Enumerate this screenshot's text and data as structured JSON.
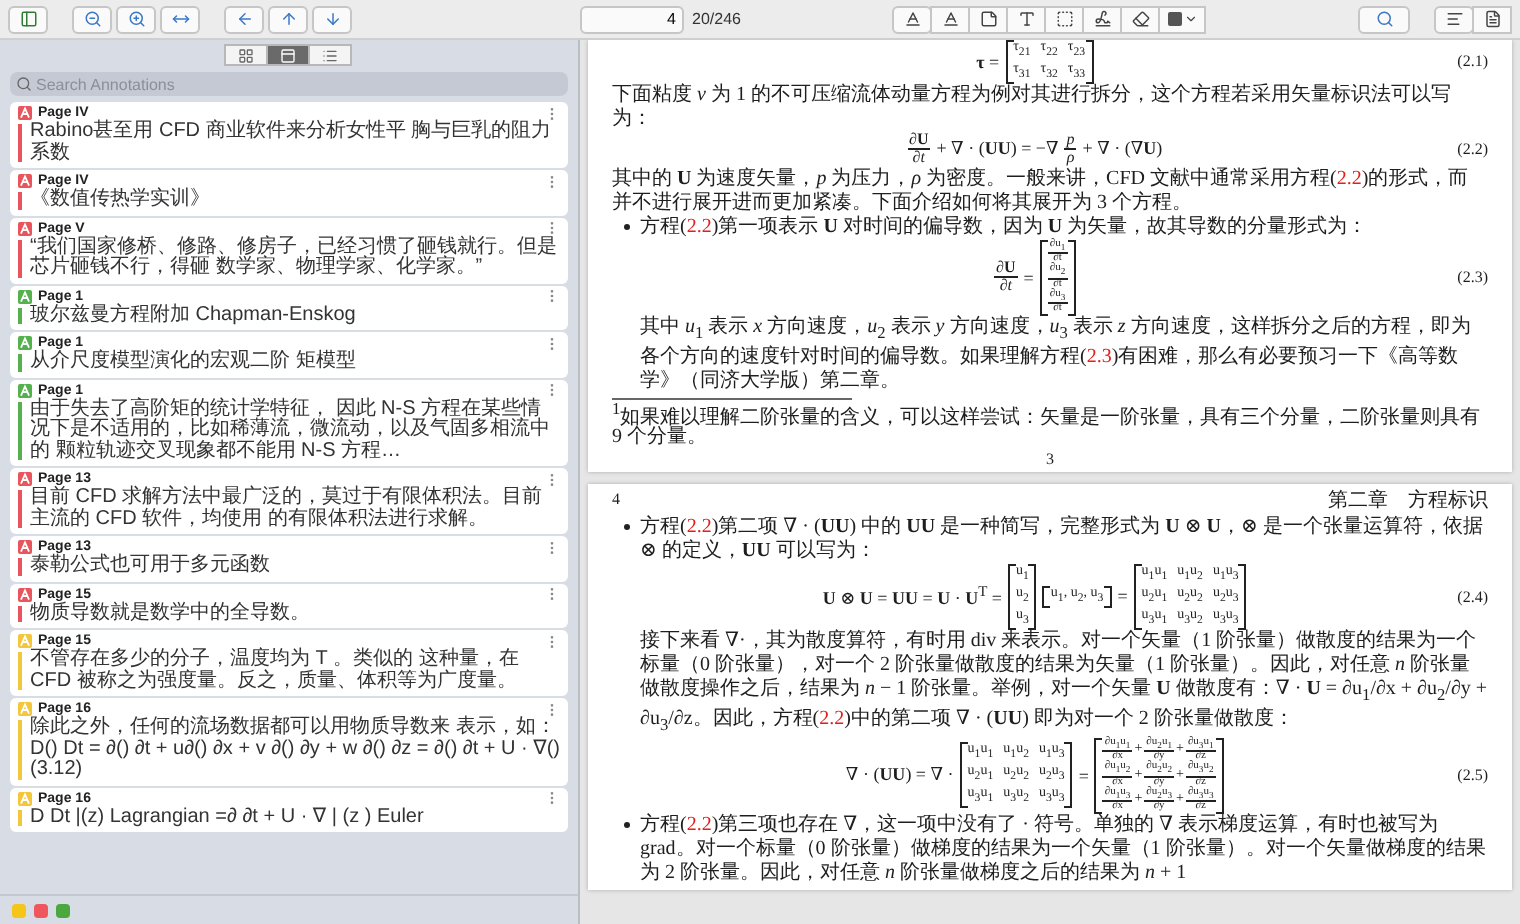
{
  "toolbar": {
    "page_field": {
      "value": "4"
    },
    "page_count": "20/246"
  },
  "sidebar": {
    "view_tabs": [
      {
        "kind": "thumbnails",
        "selected": false
      },
      {
        "kind": "annotations",
        "selected": true
      },
      {
        "kind": "outline",
        "selected": false
      }
    ],
    "search": {
      "placeholder": "Search Annotations"
    },
    "annotations": [
      {
        "page": "Page IV",
        "color": "#e8555c",
        "text": "Rabino甚至用 CFD 商业软件来分析女性平 胸与巨乳的阻力系数"
      },
      {
        "page": "Page IV",
        "color": "#e8555c",
        "text": "《数值传热学实训》"
      },
      {
        "page": "Page V",
        "color": "#e8555c",
        "text": "“我们国家修桥、修路、修房子，已经习惯了砸钱就行。但是芯片砸钱不行，得砸 数学家、物理学家、化学家。”"
      },
      {
        "page": "Page 1",
        "color": "#55b04e",
        "text": "玻尔兹曼方程附加 Chapman-Enskog"
      },
      {
        "page": "Page 1",
        "color": "#55b04e",
        "text": "从介尺度模型演化的宏观二阶 矩模型"
      },
      {
        "page": "Page 1",
        "color": "#55b04e",
        "text": "由于失去了高阶矩的统计学特征， 因此 N-S 方程在某些情况下是不适用的，比如稀薄流，微流动，以及气固多相流中的 颗粒轨迹交叉现象都不能用 N-S 方程…"
      },
      {
        "page": "Page 13",
        "color": "#e8555c",
        "text": "目前 CFD 求解方法中最广泛的，莫过于有限体积法。目前主流的 CFD 软件，均使用 的有限体积法进行求解。"
      },
      {
        "page": "Page 13",
        "color": "#e8555c",
        "text": "泰勒公式也可用于多元函数"
      },
      {
        "page": "Page 15",
        "color": "#e8555c",
        "text": "物质导数就是数学中的全导数。"
      },
      {
        "page": "Page 15",
        "color": "#f2c73c",
        "text": "不管存在多少的分子，温度均为 T 。类似的 这种量，在 CFD 被称之为强度量。反之，质量、体积等为广度量。"
      },
      {
        "page": "Page 16",
        "color": "#f2c73c",
        "text": "除此之外，任何的流场数据都可以用物质导数来 表示，如： D() Dt = ∂() ∂t + u∂() ∂x + v ∂() ∂y + w ∂() ∂z = ∂() ∂t + U · ∇() (3.12)"
      },
      {
        "page": "Page 16",
        "color": "#f2c73c",
        "text": "D Dt |(z) Lagrangian =∂ ∂t + U · ∇ | (z ) Euler"
      }
    ],
    "color_filters": [
      {
        "color": "#f5c518"
      },
      {
        "color": "#f0575c"
      },
      {
        "color": "#4aa83f"
      }
    ]
  },
  "document": {
    "pages": [
      {
        "blocks": [
          {
            "kind": "equation",
            "number": "(2.1)",
            "parts": [
              {
                "kind": "text",
                "text": "**τ** ="
              },
              {
                "kind": "matrix",
                "rows": [
                  [
                    "τ$_{21}$",
                    "τ$_{22}$",
                    "τ$_{23}$"
                  ],
                  [
                    "τ$_{31}$",
                    "τ$_{32}$",
                    "τ$_{33}$"
                  ]
                ]
              }
            ]
          },
          {
            "kind": "paragraph",
            "segments": [
              {
                "kind": "plain",
                "text": "下面粘度 *ν* 为 1 的不可压缩流体动量方程为例对其进行拆分，这个方程若采用矢量标识法可以写为："
              }
            ]
          },
          {
            "kind": "equation",
            "number": "(2.2)",
            "parts": [
              {
                "kind": "frac",
                "num": "∂**U**",
                "den": "∂*t*"
              },
              {
                "kind": "text",
                "text": "+ ∇ · (**UU**) = −∇"
              },
              {
                "kind": "frac",
                "num": "*p*",
                "den": "*ρ*"
              },
              {
                "kind": "text",
                "text": "+ ∇ · (∇**U**)"
              }
            ]
          },
          {
            "kind": "paragraph",
            "segments": [
              {
                "kind": "plain",
                "text": "其中的 **U** 为速度矢量，*p* 为压力，*ρ* 为密度。一般来讲，CFD 文献中通常采用方程("
              },
              {
                "kind": "ref",
                "text": "2.2"
              },
              {
                "kind": "plain",
                "text": ")的形式，而并不进行展开进而更加紧凑。下面介绍如何将其展开为 3 个方程。"
              }
            ]
          },
          {
            "kind": "bullet",
            "segments": [
              {
                "kind": "plain",
                "text": "方程("
              },
              {
                "kind": "ref",
                "text": "2.2"
              },
              {
                "kind": "plain",
                "text": ")第一项表示 **U** 对时间的偏导数，因为 **U** 为矢量，故其导数的分量形式为："
              }
            ]
          },
          {
            "kind": "equation",
            "number": "(2.3)",
            "parts": [
              {
                "kind": "frac",
                "num": "∂**U**",
                "den": "∂*t*"
              },
              {
                "kind": "text",
                "text": "="
              },
              {
                "kind": "matrix",
                "rows": [
                  [
                    {
                      "num": "∂u$_{1}$",
                      "den": "∂t"
                    }
                  ],
                  [
                    {
                      "num": "∂u$_{2}$",
                      "den": "∂t"
                    }
                  ],
                  [
                    {
                      "num": "∂u$_{3}$",
                      "den": "∂t"
                    }
                  ]
                ]
              }
            ]
          },
          {
            "kind": "indented",
            "segments": [
              {
                "kind": "plain",
                "text": "其中 *u*$_{1}$ 表示 *x* 方向速度，*u*$_{2}$ 表示 *y* 方向速度，*u*$_{3}$ 表示 *z* 方向速度，这样拆分之后的方程，即为各个方向的速度针对时间的偏导数。如果理解方程("
              },
              {
                "kind": "ref",
                "text": "2.3"
              },
              {
                "kind": "plain",
                "text": ")有困难，那么有必要预习一下《高等数学》（同济大学版）第二章。"
              }
            ]
          }
        ],
        "footnote": "$^{1}$如果难以理解二阶张量的含义，可以这样尝试：矢量是一阶张量，具有三个分量，二阶张量则具有 9 个分量。",
        "page_number": "3"
      },
      {
        "header": {
          "number": "4",
          "chapter": "第二章　方程标识"
        },
        "blocks": [
          {
            "kind": "bullet",
            "segments": [
              {
                "kind": "plain",
                "text": "方程("
              },
              {
                "kind": "ref",
                "text": "2.2"
              },
              {
                "kind": "plain",
                "text": ")第二项 ∇ · (**UU**) 中的 **UU** 是一种简写，完整形式为 **U** ⊗ **U**，⊗ 是一个张量运算符，依据 ⊗ 的定义，**UU** 可以写为："
              }
            ]
          },
          {
            "kind": "equation",
            "number": "(2.4)",
            "parts": [
              {
                "kind": "text",
                "text": "**U** ⊗ **U** = **UU** = **U** · **U**$^{T}$ ="
              },
              {
                "kind": "matrix",
                "rows": [
                  [
                    "u$_{1}$"
                  ],
                  [
                    "u$_{2}$"
                  ],
                  [
                    "u$_{3}$"
                  ]
                ]
              },
              {
                "kind": "matrix",
                "rows": [
                  [
                    "u$_{1}$, u$_{2}$, u$_{3}$"
                  ]
                ]
              },
              {
                "kind": "text",
                "text": "="
              },
              {
                "kind": "matrix",
                "rows": [
                  [
                    "u$_{1}$u$_{1}$",
                    "u$_{1}$u$_{2}$",
                    "u$_{1}$u$_{3}$"
                  ],
                  [
                    "u$_{2}$u$_{1}$",
                    "u$_{2}$u$_{2}$",
                    "u$_{2}$u$_{3}$"
                  ],
                  [
                    "u$_{3}$u$_{1}$",
                    "u$_{3}$u$_{2}$",
                    "u$_{3}$u$_{3}$"
                  ]
                ]
              }
            ]
          },
          {
            "kind": "indented",
            "segments": [
              {
                "kind": "plain",
                "text": "接下来看 ∇·，其为散度算符，有时用 div 来表示。对一个矢量（1 阶张量）做散度的结果为一个标量（0 阶张量），对一个 2 阶张量做散度的结果为矢量（1 阶张量）。因此，对任意 *n* 阶张量做散度操作之后，结果为 *n* − 1 阶张量。举例，对一个矢量 **U** 做散度有：∇ · **U** = ∂u$_{1}$/∂x + ∂u$_{2}$/∂y + ∂u$_{3}$/∂z。因此，方程("
              },
              {
                "kind": "ref",
                "text": "2.2"
              },
              {
                "kind": "plain",
                "text": ")中的第二项 ∇ · (**UU**) 即为对一个 2 阶张量做散度："
              }
            ]
          },
          {
            "kind": "equation",
            "number": "(2.5)",
            "parts": [
              {
                "kind": "text",
                "text": "∇ · (**UU**) = ∇ ·"
              },
              {
                "kind": "matrix",
                "rows": [
                  [
                    "u$_{1}$u$_{1}$",
                    "u$_{1}$u$_{2}$",
                    "u$_{1}$u$_{3}$"
                  ],
                  [
                    "u$_{2}$u$_{1}$",
                    "u$_{2}$u$_{2}$",
                    "u$_{2}$u$_{3}$"
                  ],
                  [
                    "u$_{3}$u$_{1}$",
                    "u$_{3}$u$_{2}$",
                    "u$_{3}$u$_{3}$"
                  ]
                ]
              },
              {
                "kind": "text",
                "text": "="
              },
              {
                "kind": "matrix",
                "rows": [
                  [
                    [
                      {
                        "num": "∂u$_{1}$u$_{1}$",
                        "den": "∂x"
                      },
                      "+",
                      {
                        "num": "∂u$_{2}$u$_{1}$",
                        "den": "∂y"
                      },
                      "+",
                      {
                        "num": "∂u$_{3}$u$_{1}$",
                        "den": "∂z"
                      }
                    ]
                  ],
                  [
                    [
                      {
                        "num": "∂u$_{1}$u$_{2}$",
                        "den": "∂x"
                      },
                      "+",
                      {
                        "num": "∂u$_{2}$u$_{2}$",
                        "den": "∂y"
                      },
                      "+",
                      {
                        "num": "∂u$_{3}$u$_{2}$",
                        "den": "∂z"
                      }
                    ]
                  ],
                  [
                    [
                      {
                        "num": "∂u$_{1}$u$_{3}$",
                        "den": "∂x"
                      },
                      "+",
                      {
                        "num": "∂u$_{2}$u$_{3}$",
                        "den": "∂y"
                      },
                      "+",
                      {
                        "num": "∂u$_{3}$u$_{3}$",
                        "den": "∂z"
                      }
                    ]
                  ]
                ]
              }
            ]
          },
          {
            "kind": "bullet",
            "segments": [
              {
                "kind": "plain",
                "text": "方程("
              },
              {
                "kind": "ref",
                "text": "2.2"
              },
              {
                "kind": "plain",
                "text": ")第三项也存在 ∇，这一项中没有了 · 符号。单独的 ∇ 表示梯度运算，有时也被写为 grad。对一个标量（0 阶张量）做梯度的结果为一个矢量（1 阶张量）。对一个矢量做梯度的结果为 2 阶张量。因此，对任意 *n* 阶张量做梯度之后的结果为 *n* + 1"
              }
            ]
          }
        ]
      }
    ]
  }
}
